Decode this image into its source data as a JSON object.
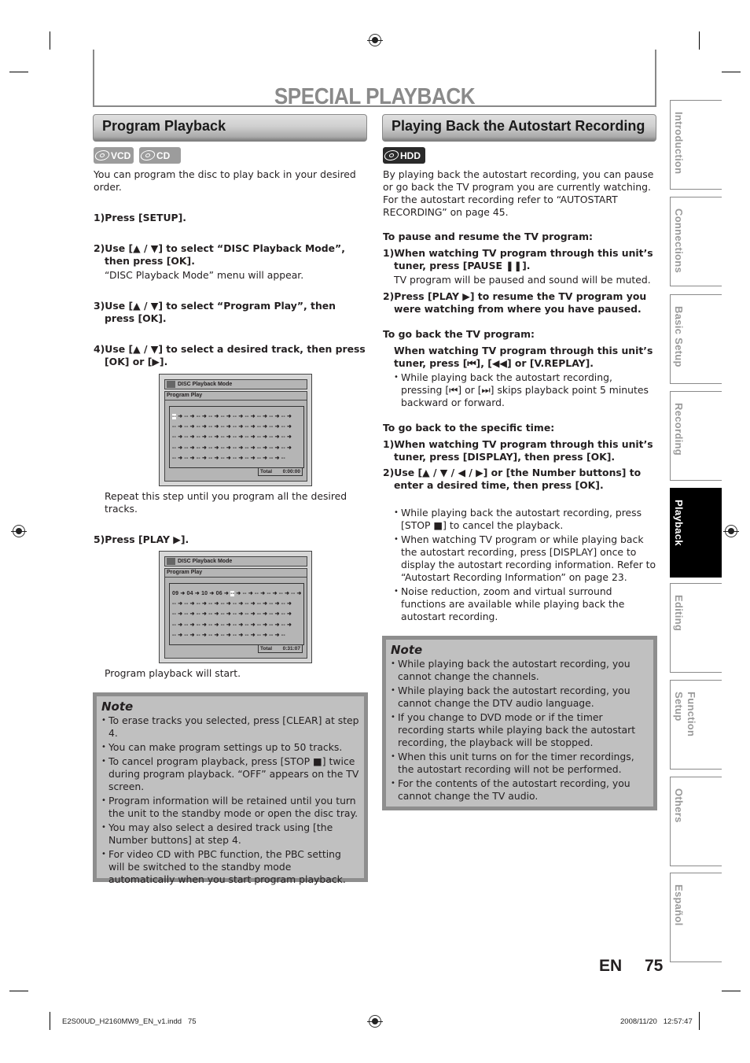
{
  "page_title": "SPECIAL PLAYBACK",
  "left": {
    "heading": "Program Playback",
    "badges": [
      "VCD",
      "CD"
    ],
    "intro": "You can program the disc to play back in your desired order.",
    "steps": [
      {
        "num": "1)",
        "text": "Press [SETUP]."
      },
      {
        "num": "2)",
        "text": "Use [▲ / ▼] to select “DISC Playback Mode”, then press [OK].",
        "sub": "“DISC Playback Mode” menu will appear."
      },
      {
        "num": "3)",
        "text": "Use [▲ / ▼] to select “Program Play”, then press [OK]."
      },
      {
        "num": "4)",
        "text": "Use [▲ / ▼] to select a desired track, then press [OK] or [▶].",
        "sub": "Repeat this step until you program all the desired tracks."
      },
      {
        "num": "5)",
        "text": "Press [PLAY ▶].",
        "sub": "Program playback will start."
      }
    ],
    "screens": [
      {
        "menu_title": "DISC Playback Mode",
        "submenu": "Program Play",
        "rows": [
          [
            "--",
            "--",
            "--",
            "--",
            "--",
            "--",
            "--",
            "--",
            "--",
            "--"
          ],
          [
            "--",
            "--",
            "--",
            "--",
            "--",
            "--",
            "--",
            "--",
            "--",
            "--"
          ],
          [
            "--",
            "--",
            "--",
            "--",
            "--",
            "--",
            "--",
            "--",
            "--",
            "--"
          ],
          [
            "--",
            "--",
            "--",
            "--",
            "--",
            "--",
            "--",
            "--",
            "--",
            "--"
          ],
          [
            "--",
            "--",
            "--",
            "--",
            "--",
            "--",
            "--",
            "--",
            "--",
            "--"
          ]
        ],
        "total_label": "Total",
        "total_value": "0:00:00"
      },
      {
        "menu_title": "DISC Playback Mode",
        "submenu": "Program Play",
        "rows": [
          [
            "09",
            "04",
            "10",
            "06",
            "--",
            "--",
            "--",
            "--",
            "--",
            "--"
          ],
          [
            "--",
            "--",
            "--",
            "--",
            "--",
            "--",
            "--",
            "--",
            "--",
            "--"
          ],
          [
            "--",
            "--",
            "--",
            "--",
            "--",
            "--",
            "--",
            "--",
            "--",
            "--"
          ],
          [
            "--",
            "--",
            "--",
            "--",
            "--",
            "--",
            "--",
            "--",
            "--",
            "--"
          ],
          [
            "--",
            "--",
            "--",
            "--",
            "--",
            "--",
            "--",
            "--",
            "--",
            "--"
          ]
        ],
        "total_label": "Total",
        "total_value": "0:31:07"
      }
    ],
    "note": {
      "title": "Note",
      "items": [
        "To erase tracks you selected, press [CLEAR] at step 4.",
        "You can make program settings up to 50 tracks.",
        "To cancel program playback, press [STOP ■] twice during program playback. “OFF” appears on the TV screen.",
        "Program information will be retained until you turn the unit to the standby mode or open the disc tray.",
        "You may also select a desired track using [the Number buttons] at step 4.",
        "For video CD with PBC function, the PBC setting will be switched to the standby mode automatically when you start program playback."
      ]
    }
  },
  "right": {
    "heading": "Playing Back the Autostart Recording",
    "badge": "HDD",
    "intro": "By playing back the autostart recording, you can pause or go back the TV program you are currently watching. For the autostart recording refer to “AUTOSTART RECORDING” on page 45.",
    "sections": [
      {
        "title": "To pause and resume the TV program:",
        "steps": [
          {
            "num": "1)",
            "text": "When watching TV program through this unit’s tuner, press [PAUSE ❚❚].",
            "sub": "TV program will be paused and sound will be muted."
          },
          {
            "num": "2)",
            "text": "Press [PLAY ▶] to resume the TV program you were watching from where you have paused."
          }
        ]
      },
      {
        "title": "To go back the TV program:",
        "steps": [
          {
            "num": "",
            "text": "When watching TV program through this unit’s tuner, press [⏮], [◀◀] or [V.REPLAY].",
            "bullet": "While playing back the autostart recording, pressing [⏮] or [⏭] skips playback point 5 minutes backward or forward."
          }
        ]
      },
      {
        "title": "To go back to the specific time:",
        "steps": [
          {
            "num": "1)",
            "text": "When watching TV program through this unit’s tuner, press [DISPLAY], then press [OK]."
          },
          {
            "num": "2)",
            "text": "Use [▲ / ▼ / ◀ / ▶] or [the Number buttons] to enter a desired time, then press [OK]."
          }
        ]
      }
    ],
    "bullets": [
      "While playing back the autostart recording, press [STOP ■] to cancel the playback.",
      "When watching TV program or while playing back the autostart recording, press [DISPLAY] once to display the autostart recording information. Refer to “Autostart Recording Information” on page 23.",
      "Noise reduction, zoom and virtual surround functions are available while playing back the autostart recording."
    ],
    "note": {
      "title": "Note",
      "items": [
        "While playing back the autostart recording, you cannot change the channels.",
        "While playing back the autostart recording, you cannot change the DTV audio language.",
        "If you change to DVD mode or if the timer recording starts while playing back the autostart recording, the playback will be stopped.",
        "When this unit turns on for the timer recordings, the autostart recording will not be performed.",
        "For the contents of the autostart recording, you cannot change the TV audio."
      ]
    }
  },
  "side_tabs": [
    {
      "label": "Introduction",
      "active": false
    },
    {
      "label": "Connections",
      "active": false
    },
    {
      "label": "Basic Setup",
      "active": false
    },
    {
      "label": "Recording",
      "active": false
    },
    {
      "label": "Playback",
      "active": true
    },
    {
      "label": "Editing",
      "active": false
    },
    {
      "label": "Function Setup",
      "active": false
    },
    {
      "label": "Others",
      "active": false
    },
    {
      "label": "Español",
      "active": false
    }
  ],
  "page_lang": "EN",
  "page_number": "75",
  "footer": {
    "file": "E2S00UD_H2160MW9_EN_v1.indd   75",
    "timestamp": "2008/11/20   12:57:47"
  }
}
